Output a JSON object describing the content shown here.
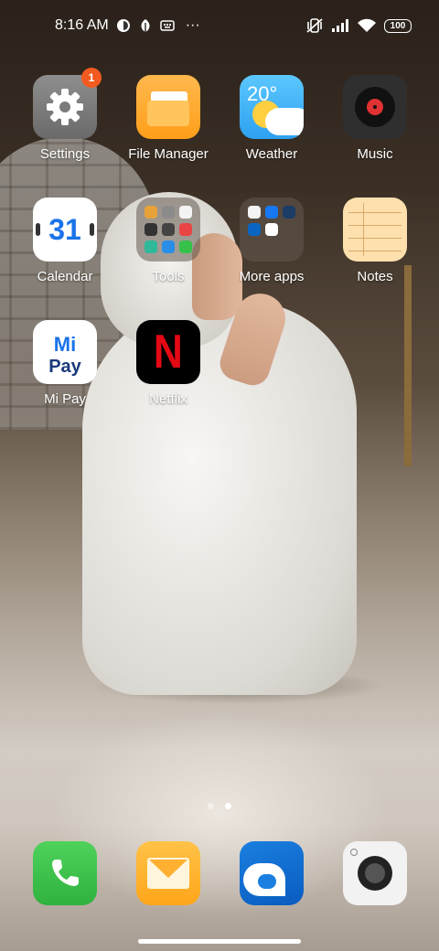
{
  "status_bar": {
    "time": "8:16 AM",
    "battery": "100",
    "more": "···"
  },
  "apps": [
    {
      "label": "Settings",
      "badge": "1"
    },
    {
      "label": "File Manager"
    },
    {
      "label": "Weather",
      "temp": "20°"
    },
    {
      "label": "Music"
    },
    {
      "label": "Calendar",
      "date": "31"
    },
    {
      "label": "Tools"
    },
    {
      "label": "More apps"
    },
    {
      "label": "Notes"
    },
    {
      "label": "Mi Pay",
      "mi": "Mi",
      "pay": "Pay"
    },
    {
      "label": "Netflix",
      "glyph": "N"
    }
  ],
  "pager": {
    "pages": 2,
    "active": 2
  },
  "colors": {
    "badge": "#f25a1f",
    "netflix_red": "#e50914",
    "phone_green": "#3cc04b",
    "calendar_blue": "#1a73e8"
  },
  "icons": {
    "dock": [
      "phone-icon",
      "messaging-icon",
      "browser-icon",
      "camera-icon"
    ]
  }
}
